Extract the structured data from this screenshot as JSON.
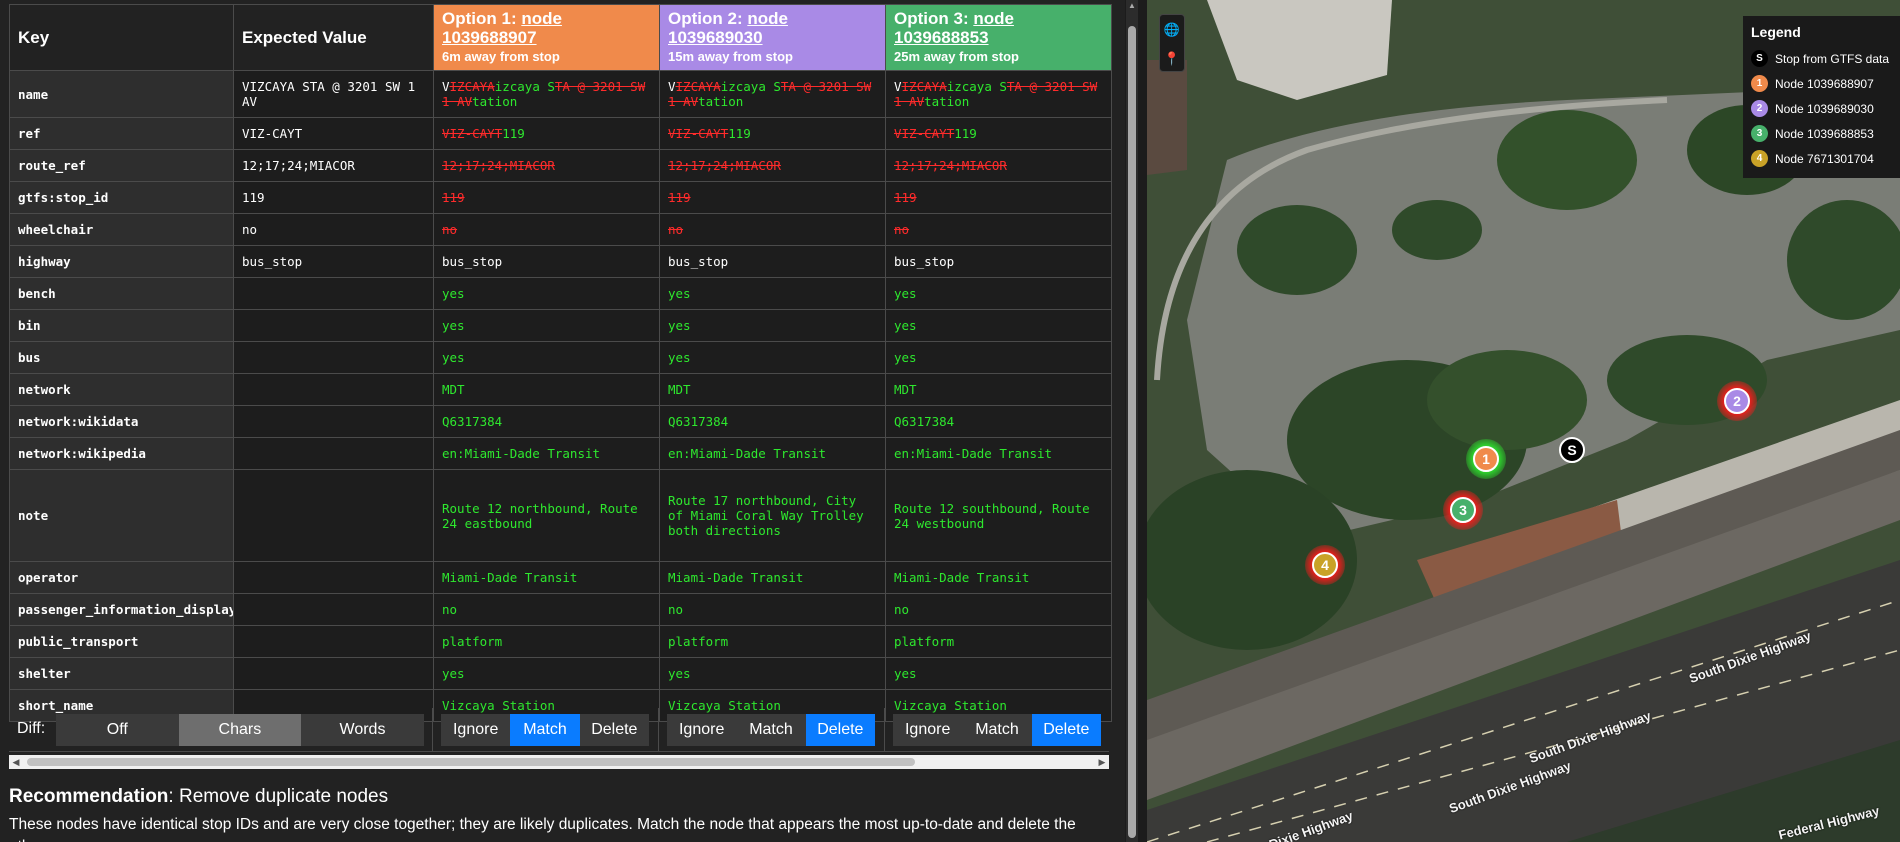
{
  "table": {
    "headers": {
      "key": "Key",
      "expected": "Expected Value",
      "options": [
        {
          "prefix": "Option 1: ",
          "node": "node 1039688907",
          "distance": "6m away from stop"
        },
        {
          "prefix": "Option 2: ",
          "node": "node 1039689030",
          "distance": "15m away from stop"
        },
        {
          "prefix": "Option 3: ",
          "node": "node 1039688853",
          "distance": "25m away from stop"
        }
      ]
    },
    "rows": [
      {
        "key": "name",
        "expected": "VIZCAYA STA @ 3201 SW 1 AV",
        "size": "r47",
        "opts": [
          [
            {
              "t": "V",
              "c": "w"
            },
            {
              "t": "IZCAYA",
              "c": "rd"
            },
            {
              "t": "izcaya S",
              "c": "g"
            },
            {
              "t": "TA @ 3201 SW 1 AV",
              "c": "rd"
            },
            {
              "t": "tation",
              "c": "g"
            }
          ],
          [
            {
              "t": "V",
              "c": "w"
            },
            {
              "t": "IZCAYA",
              "c": "rd"
            },
            {
              "t": "izcaya S",
              "c": "g"
            },
            {
              "t": "TA @ 3201 SW 1 AV",
              "c": "rd"
            },
            {
              "t": "tation",
              "c": "g"
            }
          ],
          [
            {
              "t": "V",
              "c": "w"
            },
            {
              "t": "IZCAYA",
              "c": "rd"
            },
            {
              "t": "izcaya S",
              "c": "g"
            },
            {
              "t": "TA @ 3201 SW 1 AV",
              "c": "rd"
            },
            {
              "t": "tation",
              "c": "g"
            }
          ]
        ]
      },
      {
        "key": "ref",
        "expected": "VIZ-CAYT",
        "size": "r32",
        "opts": [
          [
            {
              "t": "VIZ-CAYT",
              "c": "rd"
            },
            {
              "t": "119",
              "c": "g"
            }
          ],
          [
            {
              "t": "VIZ-CAYT",
              "c": "rd"
            },
            {
              "t": "119",
              "c": "g"
            }
          ],
          [
            {
              "t": "VIZ-CAYT",
              "c": "rd"
            },
            {
              "t": "119",
              "c": "g"
            }
          ]
        ]
      },
      {
        "key": "route_ref",
        "expected": "12;17;24;MIACOR",
        "size": "r32",
        "opts": [
          [
            {
              "t": "12;17;24;MIACOR",
              "c": "rd"
            }
          ],
          [
            {
              "t": "12;17;24;MIACOR",
              "c": "rd"
            }
          ],
          [
            {
              "t": "12;17;24;MIACOR",
              "c": "rd"
            }
          ]
        ]
      },
      {
        "key": "gtfs:stop_id",
        "expected": "119",
        "size": "r32",
        "opts": [
          [
            {
              "t": "119",
              "c": "rd"
            }
          ],
          [
            {
              "t": "119",
              "c": "rd"
            }
          ],
          [
            {
              "t": "119",
              "c": "rd"
            }
          ]
        ]
      },
      {
        "key": "wheelchair",
        "expected": "no",
        "size": "r32",
        "opts": [
          [
            {
              "t": "no",
              "c": "rd"
            }
          ],
          [
            {
              "t": "no",
              "c": "rd"
            }
          ],
          [
            {
              "t": "no",
              "c": "rd"
            }
          ]
        ]
      },
      {
        "key": "highway",
        "expected": "bus_stop",
        "size": "r32",
        "opts": [
          [
            {
              "t": "bus_stop",
              "c": "w"
            }
          ],
          [
            {
              "t": "bus_stop",
              "c": "w"
            }
          ],
          [
            {
              "t": "bus_stop",
              "c": "w"
            }
          ]
        ]
      },
      {
        "key": "bench",
        "expected": "",
        "size": "r32",
        "opts": [
          [
            {
              "t": "yes",
              "c": "g"
            }
          ],
          [
            {
              "t": "yes",
              "c": "g"
            }
          ],
          [
            {
              "t": "yes",
              "c": "g"
            }
          ]
        ]
      },
      {
        "key": "bin",
        "expected": "",
        "size": "r32",
        "opts": [
          [
            {
              "t": "yes",
              "c": "g"
            }
          ],
          [
            {
              "t": "yes",
              "c": "g"
            }
          ],
          [
            {
              "t": "yes",
              "c": "g"
            }
          ]
        ]
      },
      {
        "key": "bus",
        "expected": "",
        "size": "r32",
        "opts": [
          [
            {
              "t": "yes",
              "c": "g"
            }
          ],
          [
            {
              "t": "yes",
              "c": "g"
            }
          ],
          [
            {
              "t": "yes",
              "c": "g"
            }
          ]
        ]
      },
      {
        "key": "network",
        "expected": "",
        "size": "r32",
        "opts": [
          [
            {
              "t": "MDT",
              "c": "g"
            }
          ],
          [
            {
              "t": "MDT",
              "c": "g"
            }
          ],
          [
            {
              "t": "MDT",
              "c": "g"
            }
          ]
        ]
      },
      {
        "key": "network:wikidata",
        "expected": "",
        "size": "r32",
        "opts": [
          [
            {
              "t": "Q6317384",
              "c": "g"
            }
          ],
          [
            {
              "t": "Q6317384",
              "c": "g"
            }
          ],
          [
            {
              "t": "Q6317384",
              "c": "g"
            }
          ]
        ]
      },
      {
        "key": "network:wikipedia",
        "expected": "",
        "size": "r32",
        "opts": [
          [
            {
              "t": "en:Miami-Dade Transit",
              "c": "g"
            }
          ],
          [
            {
              "t": "en:Miami-Dade Transit",
              "c": "g"
            }
          ],
          [
            {
              "t": "en:Miami-Dade Transit",
              "c": "g"
            }
          ]
        ]
      },
      {
        "key": "note",
        "expected": "",
        "size": "r92",
        "opts": [
          [
            {
              "t": "Route 12 northbound, Route 24 eastbound",
              "c": "g"
            }
          ],
          [
            {
              "t": "Route 17 northbound, City of Miami Coral Way Trolley both directions",
              "c": "g"
            }
          ],
          [
            {
              "t": "Route 12 southbound, Route 24 westbound",
              "c": "g"
            }
          ]
        ]
      },
      {
        "key": "operator",
        "expected": "",
        "size": "r32",
        "opts": [
          [
            {
              "t": "Miami-Dade Transit",
              "c": "g"
            }
          ],
          [
            {
              "t": "Miami-Dade Transit",
              "c": "g"
            }
          ],
          [
            {
              "t": "Miami-Dade Transit",
              "c": "g"
            }
          ]
        ]
      },
      {
        "key": "passenger_information_display",
        "expected": "",
        "size": "r32",
        "opts": [
          [
            {
              "t": "no",
              "c": "g"
            }
          ],
          [
            {
              "t": "no",
              "c": "g"
            }
          ],
          [
            {
              "t": "no",
              "c": "g"
            }
          ]
        ]
      },
      {
        "key": "public_transport",
        "expected": "",
        "size": "r32",
        "opts": [
          [
            {
              "t": "platform",
              "c": "g"
            }
          ],
          [
            {
              "t": "platform",
              "c": "g"
            }
          ],
          [
            {
              "t": "platform",
              "c": "g"
            }
          ]
        ]
      },
      {
        "key": "shelter",
        "expected": "",
        "size": "r32",
        "opts": [
          [
            {
              "t": "yes",
              "c": "g"
            }
          ],
          [
            {
              "t": "yes",
              "c": "g"
            }
          ],
          [
            {
              "t": "yes",
              "c": "g"
            }
          ]
        ]
      },
      {
        "key": "short_name",
        "expected": "",
        "size": "r32",
        "opts": [
          [
            {
              "t": "Vizcaya Station",
              "c": "g"
            }
          ],
          [
            {
              "t": "Vizcaya Station",
              "c": "g"
            }
          ],
          [
            {
              "t": "Vizcaya Station",
              "c": "g"
            }
          ]
        ]
      }
    ]
  },
  "controls": {
    "diff_label": "Diff:",
    "diff_modes": [
      "Off",
      "Chars",
      "Words"
    ],
    "diff_active": "Chars",
    "option_actions": [
      {
        "labels": [
          "Ignore",
          "Match",
          "Delete"
        ],
        "selected": "Match"
      },
      {
        "labels": [
          "Ignore",
          "Match",
          "Delete"
        ],
        "selected": "Delete"
      },
      {
        "labels": [
          "Ignore",
          "Match",
          "Delete"
        ],
        "selected": "Delete"
      }
    ]
  },
  "recommendation": {
    "label": "Recommendation",
    "title": ": Remove duplicate nodes",
    "body": "These nodes have identical stop IDs and are very close together; they are likely duplicates. Match the node that appears the most up-to-date and delete the others."
  },
  "map": {
    "controls": {
      "globe_icon": "globe-icon",
      "pin_icon": "pin-icon"
    },
    "legend": {
      "title": "Legend",
      "items": [
        {
          "symbol": "S",
          "label": "Stop from GTFS data",
          "color": "#000000"
        },
        {
          "symbol": "1",
          "label": "Node 1039688907",
          "color": "#f08a4b"
        },
        {
          "symbol": "2",
          "label": "Node 1039689030",
          "color": "#a98ae6"
        },
        {
          "symbol": "3",
          "label": "Node 1039688853",
          "color": "#47b06b"
        },
        {
          "symbol": "4",
          "label": "Node 7671301704",
          "color": "#c9a227"
        }
      ]
    },
    "markers": {
      "stop": {
        "symbol": "S"
      },
      "nodes": [
        {
          "symbol": "1",
          "color": "#f08a4b",
          "halo": "#2ee82e"
        },
        {
          "symbol": "2",
          "color": "#a98ae6",
          "halo": "#ff1a1a"
        },
        {
          "symbol": "3",
          "color": "#47b06b",
          "halo": "#ff1a1a"
        },
        {
          "symbol": "4",
          "color": "#c9a227",
          "halo": "#ff1a1a"
        }
      ]
    },
    "road_labels": [
      "South Dixie Highway",
      "South Dixie Highway",
      "South Dixie Highway",
      "Federal Highway",
      "Dixie Highway"
    ]
  }
}
